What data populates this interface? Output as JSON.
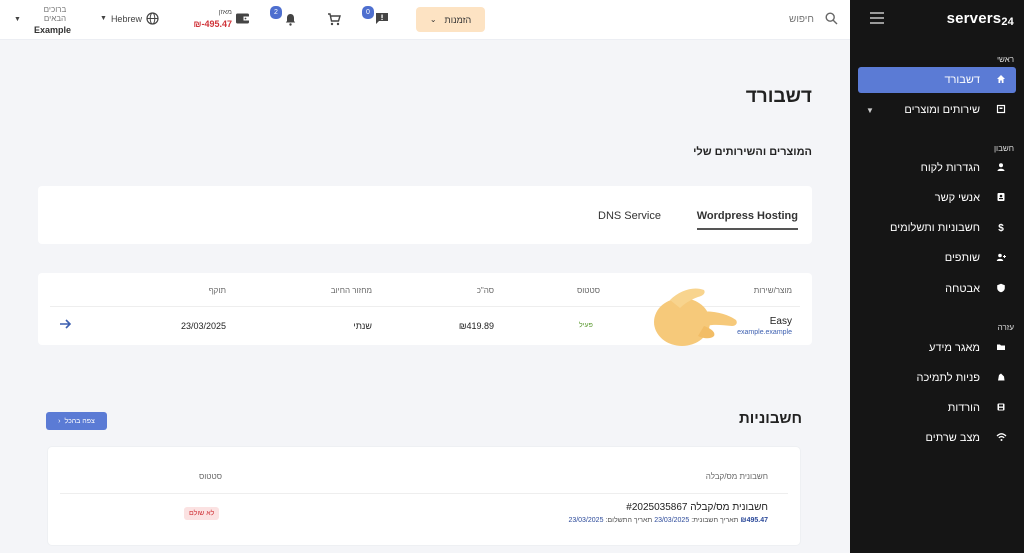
{
  "sidebar": {
    "logo": "servers",
    "logo_num": "24",
    "sections": {
      "main": "ראשי",
      "account": "חשבון",
      "help": "עזרה"
    },
    "items": [
      {
        "label": "דשבורד",
        "icon": "home-icon"
      },
      {
        "label": "שירותים ומוצרים",
        "icon": "box-icon"
      },
      {
        "label": "הגדרות לקוח",
        "icon": "user-icon"
      },
      {
        "label": "אנשי קשר",
        "icon": "contacts-icon"
      },
      {
        "label": "חשבוניות ותשלומים",
        "icon": "dollar-icon"
      },
      {
        "label": "שותפים",
        "icon": "partners-icon"
      },
      {
        "label": "אבטחה",
        "icon": "shield-icon"
      },
      {
        "label": "מאגר מידע",
        "icon": "folder-icon"
      },
      {
        "label": "פניות לתמיכה",
        "icon": "support-icon"
      },
      {
        "label": "הורדות",
        "icon": "download-icon"
      },
      {
        "label": "מצב שרתים",
        "icon": "wifi-icon"
      }
    ]
  },
  "topbar": {
    "search_placeholder": "חיפוש",
    "orders_label": "הזמנות",
    "messages_badge": "0",
    "notifications_badge": "2",
    "wallet_label": "מאזן",
    "wallet_amount": "495.47-₪",
    "language": "Hebrew",
    "welcome_line1": "ברוכים",
    "welcome_line2": "הבאים",
    "username": "Example"
  },
  "main": {
    "title": "דשבורד",
    "products_title": "המוצרים והשירותים שלי",
    "tabs": [
      "Wordpress Hosting",
      "DNS Service"
    ],
    "services_table": {
      "headers": [
        "מוצר/שירות",
        "סטטוס",
        "סה\"כ",
        "מחזור החיוב",
        "תוקף"
      ],
      "row": {
        "name": "Easy",
        "domain": "example.example",
        "status": "פעיל",
        "total": "₪419.89",
        "cycle": "שנתי",
        "expiry": "23/03/2025"
      }
    },
    "invoices": {
      "title": "חשבוניות",
      "view_all": "צפה בהכל",
      "headers": [
        "חשבונית מס/קבלה",
        "סטטוס"
      ],
      "row": {
        "name": "חשבונית מס/קבלה #2025035867",
        "amount": "₪495.47",
        "invoice_date_label": "תאריך חשבונית:",
        "invoice_date": "23/03/2025",
        "due_date_label": "תאריך התשלום:",
        "due_date": "23/03/2025",
        "status": "לא שולם"
      }
    }
  },
  "colors": {
    "sidebar_bg": "#151515",
    "accent": "#5b7bd5",
    "orders_bg": "#fde3c3",
    "negative": "#d0343a",
    "active_status": "#5a9a2f"
  }
}
